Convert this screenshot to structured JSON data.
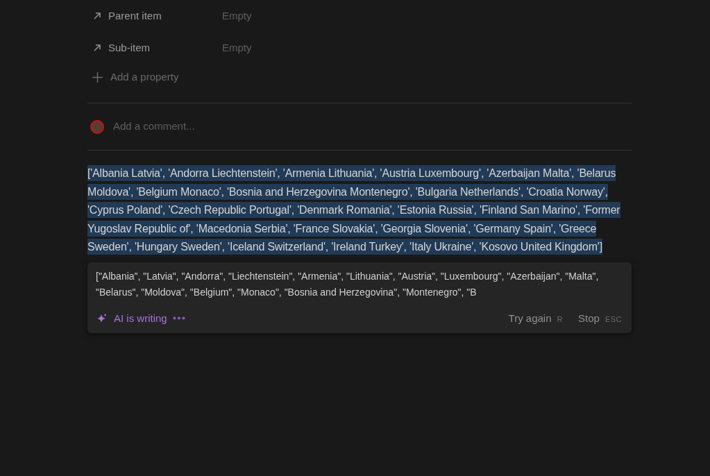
{
  "properties": [
    {
      "label": "Parent item",
      "value": "Empty"
    },
    {
      "label": "Sub-item",
      "value": "Empty"
    }
  ],
  "add_property": "Add a property",
  "comment": {
    "placeholder": "Add a comment..."
  },
  "block": {
    "text": "['Albania Latvia', 'Andorra Liechtenstein', 'Armenia Lithuania', 'Austria Luxembourg', 'Azerbaijan Malta', 'Belarus Moldova', 'Belgium Monaco', 'Bosnia and Herzegovina Montenegro', 'Bulgaria Netherlands', 'Croatia Norway', 'Cyprus Poland', 'Czech Republic Portugal', 'Denmark Romania', 'Estonia Russia', 'Finland San Marino', 'Former Yugoslav Republic of', 'Macedonia Serbia', 'France Slovakia', 'Georgia Slovenia', 'Germany Spain', 'Greece Sweden', 'Hungary Sweden', 'Iceland Switzerland', 'Ireland Turkey', 'Italy Ukraine', 'Kosovo United Kingdom']",
    "selected": true
  },
  "ai_panel": {
    "output": "[\"Albania\", \"Latvia\", \"Andorra\", \"Liechtenstein\", \"Armenia\", \"Lithuania\", \"Austria\", \"Luxembourg\", \"Azerbaijan\", \"Malta\", \"Belarus\", \"Moldova\", \"Belgium\", \"Monaco\", \"Bosnia and Herzegovina\", \"Montenegro\", \"B",
    "status": "AI is writing",
    "actions": [
      {
        "label": "Try again",
        "shortcut": "R"
      },
      {
        "label": "Stop",
        "shortcut": "ESC"
      }
    ]
  }
}
